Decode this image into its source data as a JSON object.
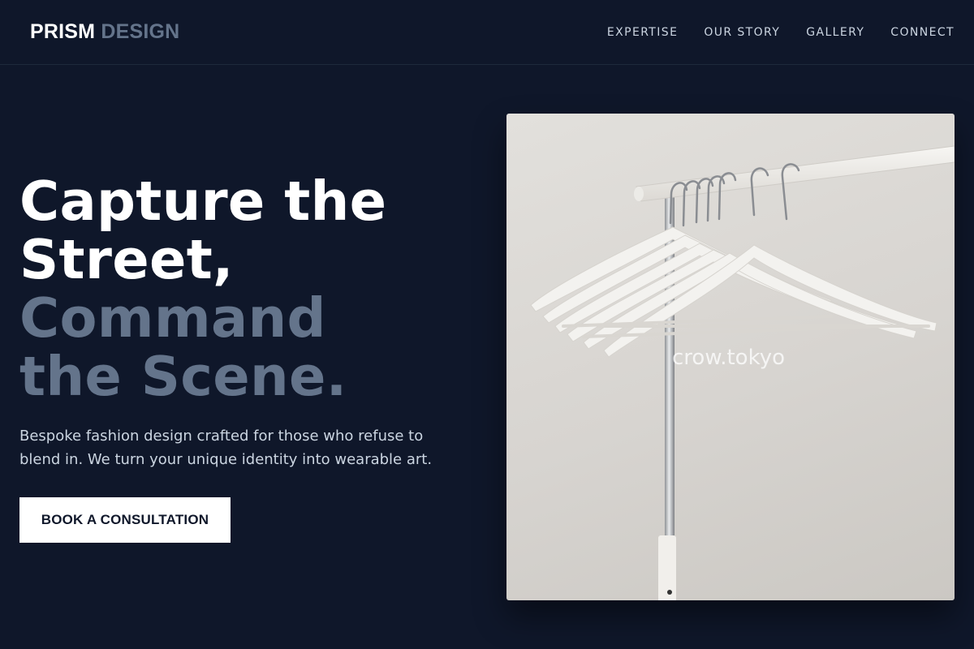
{
  "brand": {
    "logo_part1": "PRISM",
    "logo_part2": "DESIGN"
  },
  "nav": {
    "items": [
      {
        "label": "EXPERTISE"
      },
      {
        "label": "OUR STORY"
      },
      {
        "label": "GALLERY"
      },
      {
        "label": "CONNECT"
      }
    ]
  },
  "hero": {
    "title_lines": [
      "Capture the",
      "Street,",
      "Command",
      "the Scene."
    ],
    "description": "Bespoke fashion design crafted for those who refuse to blend in. We turn your unique identity into wearable art.",
    "cta_label": "BOOK A CONSULTATION",
    "image_watermark": "crow.tokyo"
  },
  "colors": {
    "background": "#0f172a",
    "accent_muted": "#64748b",
    "text_light": "#ffffff",
    "text_secondary": "#cbd5e1",
    "cta_background": "#ffffff",
    "cta_text": "#0f172a"
  }
}
